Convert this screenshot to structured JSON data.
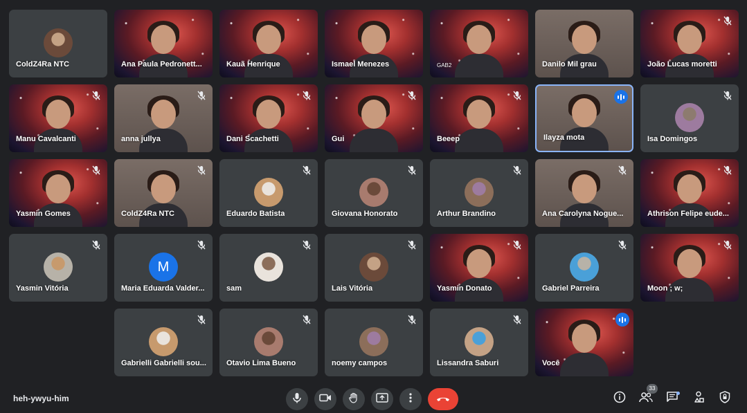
{
  "meeting": {
    "code": "heh-ywyu-him",
    "participant_count": "33"
  },
  "colors": {
    "background": "#202124",
    "tile": "#3c4043",
    "accent": "#8ab4f8",
    "hangup": "#ea4335",
    "speaking": "#1a73e8"
  },
  "tiles": [
    {
      "name": "ColdZ4Ra NTC",
      "kind": "avatar",
      "mic": "none"
    },
    {
      "name": "Ana Paula Pedronett...",
      "kind": "video",
      "mic": "none"
    },
    {
      "name": "Kauã Henrique",
      "kind": "video",
      "mic": "none"
    },
    {
      "name": "Ismael Menezes",
      "kind": "video",
      "mic": "none"
    },
    {
      "name": "GAB2",
      "kind": "video",
      "mic": "none"
    },
    {
      "name": "Danilo Mil grau",
      "kind": "video",
      "mic": "none"
    },
    {
      "name": "João Lucas moretti",
      "kind": "video",
      "mic": "muted"
    },
    {
      "name": "Manu Cavalcanti",
      "kind": "video",
      "mic": "muted"
    },
    {
      "name": "anna jullya",
      "kind": "video",
      "mic": "muted"
    },
    {
      "name": "Dani Scachetti",
      "kind": "video",
      "mic": "muted"
    },
    {
      "name": "Gui",
      "kind": "video",
      "mic": "muted"
    },
    {
      "name": "Beeep",
      "kind": "video",
      "mic": "muted"
    },
    {
      "name": "Ilayza mota",
      "kind": "video",
      "mic": "speaking"
    },
    {
      "name": "Isa Domingos",
      "kind": "avatar",
      "mic": "muted"
    },
    {
      "name": "Yasmin Gomes",
      "kind": "video",
      "mic": "muted"
    },
    {
      "name": "ColdZ4Ra NTC",
      "kind": "video",
      "mic": "muted"
    },
    {
      "name": "Eduardo Batista",
      "kind": "avatar",
      "mic": "muted"
    },
    {
      "name": "Giovana Honorato",
      "kind": "avatar",
      "mic": "muted"
    },
    {
      "name": "Arthur Brandino",
      "kind": "avatar",
      "mic": "muted"
    },
    {
      "name": "Ana Carolyna Nogue...",
      "kind": "video",
      "mic": "muted"
    },
    {
      "name": "Athrison Felipe eude...",
      "kind": "video",
      "mic": "muted"
    },
    {
      "name": "Yasmin Vitória",
      "kind": "avatar",
      "mic": "muted"
    },
    {
      "name": "Maria Eduarda Valder...",
      "kind": "avatar",
      "letter": "M",
      "mic": "muted"
    },
    {
      "name": "sam",
      "kind": "avatar",
      "mic": "muted"
    },
    {
      "name": "Lais Vitória",
      "kind": "avatar",
      "mic": "muted"
    },
    {
      "name": "Yasmin Donato",
      "kind": "video",
      "mic": "muted"
    },
    {
      "name": "Gabriel Parreira",
      "kind": "avatar",
      "mic": "muted"
    },
    {
      "name": "Moon ; w;",
      "kind": "video",
      "mic": "muted"
    },
    {
      "name": "Gabrielli Gabrielli sou...",
      "kind": "avatar",
      "mic": "muted"
    },
    {
      "name": "Otavio Lima Bueno",
      "kind": "avatar",
      "mic": "muted"
    },
    {
      "name": "noemy campos",
      "kind": "avatar",
      "mic": "muted"
    },
    {
      "name": "Lissandra Saburi",
      "kind": "avatar",
      "mic": "muted"
    },
    {
      "name": "Você",
      "kind": "video",
      "mic": "speaking"
    }
  ],
  "controls": [
    {
      "id": "mic",
      "icon": "microphone-icon"
    },
    {
      "id": "camera",
      "icon": "camera-icon"
    },
    {
      "id": "raise-hand",
      "icon": "hand-icon"
    },
    {
      "id": "present",
      "icon": "present-screen-icon"
    },
    {
      "id": "more",
      "icon": "more-vertical-icon"
    },
    {
      "id": "leave",
      "icon": "hang-up-icon"
    }
  ],
  "side_controls": [
    {
      "id": "details",
      "icon": "info-icon"
    },
    {
      "id": "people",
      "icon": "people-icon"
    },
    {
      "id": "chat",
      "icon": "chat-icon"
    },
    {
      "id": "activities",
      "icon": "activities-icon"
    },
    {
      "id": "host-controls",
      "icon": "lock-shield-icon"
    }
  ]
}
